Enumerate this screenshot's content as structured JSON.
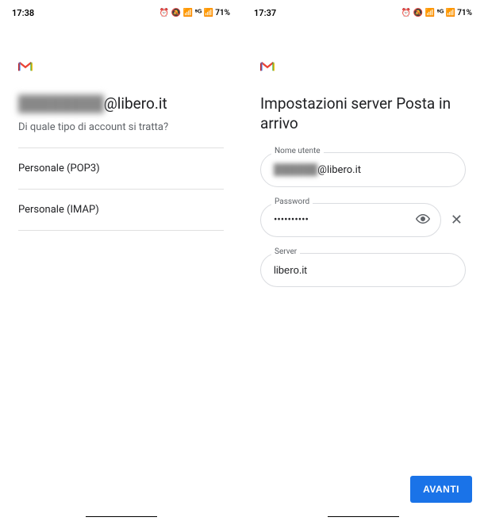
{
  "left": {
    "statusbar": {
      "time": "17:38",
      "battery": "71%",
      "icons": "⏰ 🔕 📶 ⁵ᴳ 📶"
    },
    "email_masked": "████████",
    "email_domain": "@libero.it",
    "subtitle": "Di quale tipo di account si tratta?",
    "options": [
      "Personale (POP3)",
      "Personale (IMAP)"
    ]
  },
  "right": {
    "statusbar": {
      "time": "17:37",
      "battery": "71%",
      "icons": "⏰ 🔕 📶 ⁵ᴳ 📶"
    },
    "title": "Impostazioni server Posta in arrivo",
    "fields": {
      "username": {
        "label": "Nome utente",
        "masked": "██████",
        "domain": "@libero.it"
      },
      "password": {
        "label": "Password",
        "value": "••••••••••"
      },
      "server": {
        "label": "Server",
        "value": "libero.it"
      }
    },
    "next_button": "AVANTI"
  }
}
